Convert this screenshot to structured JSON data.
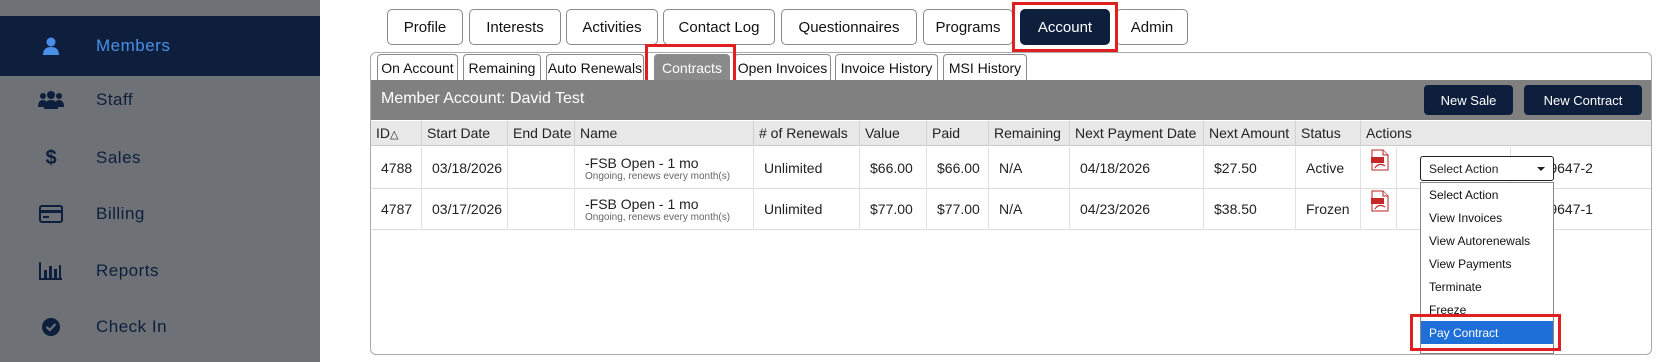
{
  "sidebar": {
    "items": [
      {
        "label": "Members",
        "icon": "user-icon",
        "active": true
      },
      {
        "label": "Staff",
        "icon": "group-icon"
      },
      {
        "label": "Sales",
        "icon": "dollar-icon"
      },
      {
        "label": "Billing",
        "icon": "credit-card-icon"
      },
      {
        "label": "Reports",
        "icon": "bar-chart-icon"
      },
      {
        "label": "Check In",
        "icon": "check-circle-icon"
      }
    ]
  },
  "top_tabs": [
    "Profile",
    "Interests",
    "Activities",
    "Contact Log",
    "Questionnaires",
    "Programs",
    "Account",
    "Admin"
  ],
  "sub_tabs": [
    "On Account",
    "Remaining",
    "Auto Renewals",
    "Contracts",
    "Open Invoices",
    "Invoice History",
    "MSI History"
  ],
  "panel": {
    "title": "Member Account: David Test",
    "new_sale": "New Sale",
    "new_contract": "New Contract"
  },
  "table": {
    "headers": [
      "ID",
      "Start Date",
      "End Date",
      "Name",
      "# of Renewals",
      "Value",
      "Paid",
      "Remaining",
      "Next Payment Date",
      "Next Amount",
      "Status",
      "Actions"
    ],
    "sort_indicator": "△",
    "rows": [
      {
        "id": "4788",
        "start": "03/18/2026",
        "end": "",
        "name": "-FSB Open - 1 mo",
        "sub": "Ongoing, renews every month(s)",
        "renewals": "Unlimited",
        "value": "$66.00",
        "paid": "$66.00",
        "remaining": "N/A",
        "next_date": "04/18/2026",
        "next_amount": "$27.50",
        "status": "Active",
        "ref": "4689647-2"
      },
      {
        "id": "4787",
        "start": "03/17/2026",
        "end": "",
        "name": "-FSB Open - 1 mo",
        "sub": "Ongoing, renews every month(s)",
        "renewals": "Unlimited",
        "value": "$77.00",
        "paid": "$77.00",
        "remaining": "N/A",
        "next_date": "04/23/2026",
        "next_amount": "$38.50",
        "status": "Frozen",
        "ref": "4689647-1"
      }
    ]
  },
  "action_select": {
    "value": "Select Action",
    "options": [
      "Select Action",
      "View Invoices",
      "View Autorenewals",
      "View Payments",
      "Terminate",
      "Freeze",
      "Pay Contract"
    ],
    "highlighted": "Pay Contract"
  },
  "colors": {
    "navy": "#0d1f3c",
    "sidebar": "#6e7176",
    "highlight_red": "#e02020",
    "option_blue": "#1e6fd8"
  }
}
